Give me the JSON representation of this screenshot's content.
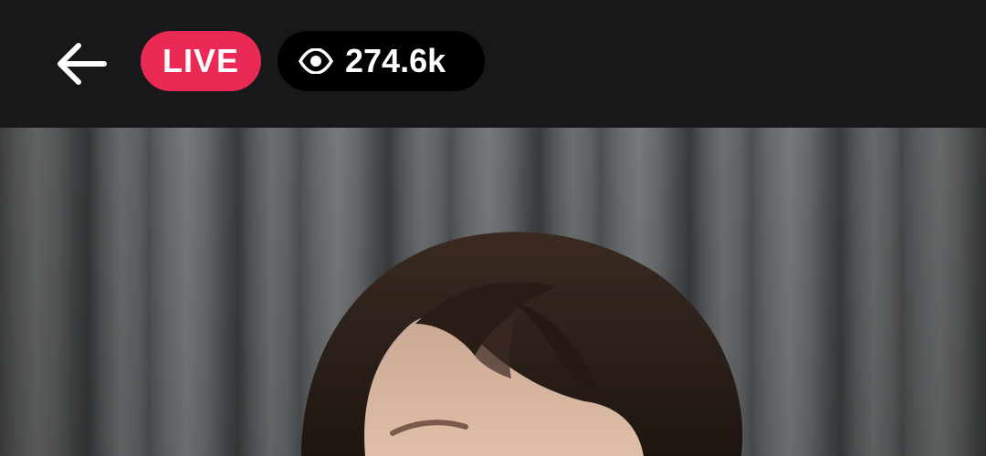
{
  "header": {
    "back_icon": "arrow-left-icon",
    "live_label": "LIVE",
    "live_color": "#ea2a55",
    "viewer_icon": "eye-icon",
    "viewer_count": "274.6k"
  },
  "stream": {
    "background_color": "#18181b"
  }
}
